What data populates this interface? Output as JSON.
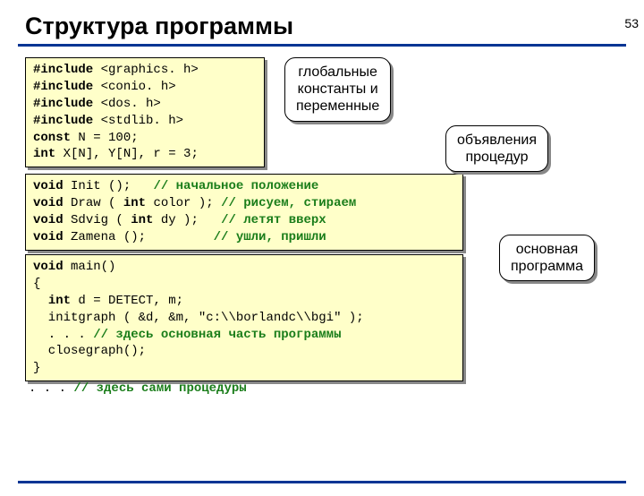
{
  "page_number": "53",
  "title": "Структура программы",
  "code": {
    "block1": {
      "l1a": "#include",
      "l1b": " <graphics. h>",
      "l2a": "#include",
      "l2b": " <conio. h>",
      "l3a": "#include",
      "l3b": " <dos. h>",
      "l4a": "#include",
      "l4b": " <stdlib. h>",
      "l5a": "const",
      "l5b": " N = ",
      "l5c": "100",
      "l5d": ";",
      "l6a": "int",
      "l6b": " X[N], Y[N], r = ",
      "l6c": "3",
      "l6d": ";"
    },
    "block2": {
      "l1a": "void",
      "l1b": " Init ();   ",
      "l1c": "// начальное положение",
      "l2a": "void",
      "l2b": " Draw ( ",
      "l2c": "int",
      "l2d": " color ); ",
      "l2e": "// рисуем, стираем",
      "l3a": "void",
      "l3b": " Sdvig ( ",
      "l3c": "int",
      "l3d": " dy );   ",
      "l3e": "// летят вверх",
      "l4a": "void",
      "l4b": " Zamena ();         ",
      "l4c": "// ушли, пришли"
    },
    "block3": {
      "l1a": "void",
      "l1b": " main()",
      "l2": "{",
      "l3a": "int",
      "l3b": " d = DETECT, m;",
      "l4a": "  initgraph ( &d, &m, ",
      "l4b": "\"c:\\\\borlandc\\\\bgi\"",
      "l4c": " );",
      "l5a": "  . . . ",
      "l5b": "// здесь основная часть программы",
      "l6": "  closegraph();",
      "l7": "}"
    },
    "tail_a": ". . . ",
    "tail_b": "// здесь сами процедуры"
  },
  "callouts": {
    "c1_l1": "глобальные",
    "c1_l2": "константы и",
    "c1_l3": "переменные",
    "c2_l1": "объявления",
    "c2_l2": "процедур",
    "c3_l1": "основная",
    "c3_l2": "программа"
  }
}
